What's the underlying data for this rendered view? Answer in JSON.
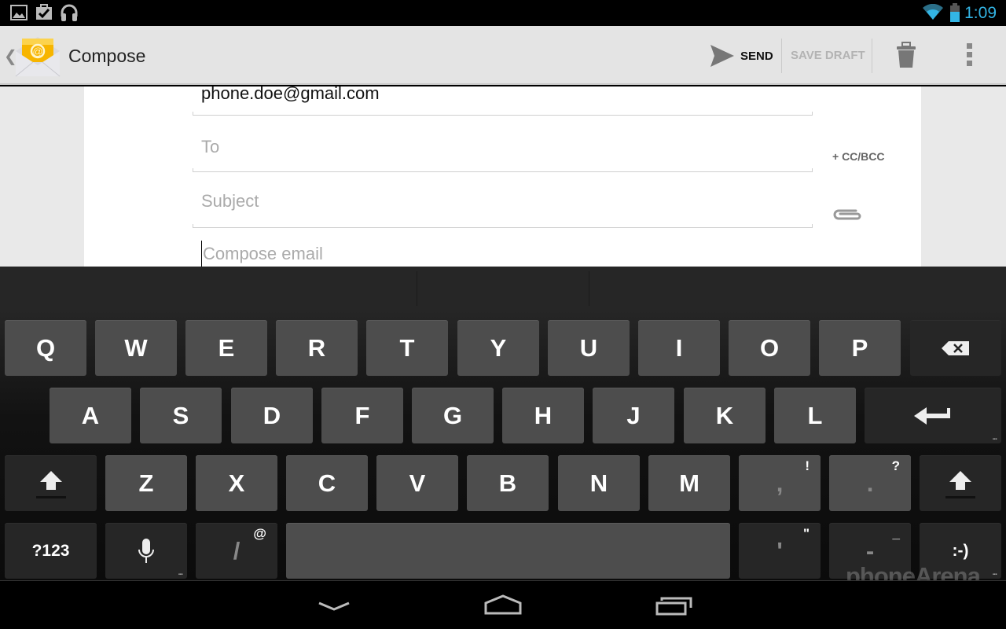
{
  "status_bar": {
    "left_icons": [
      "gallery-icon",
      "tasks-check-icon",
      "headphones-icon"
    ],
    "wifi": "wifi-icon",
    "battery": "battery-icon",
    "time": "1:09",
    "accent_color": "#33b5e5"
  },
  "action_bar": {
    "title": "Compose",
    "send_label": "SEND",
    "save_draft_label": "SAVE DRAFT",
    "delete_icon": "trash-icon",
    "overflow_icon": "overflow-menu-icon"
  },
  "compose": {
    "from": "phone.doe@gmail.com",
    "to_placeholder": "To",
    "subject_placeholder": "Subject",
    "body_placeholder": "Compose email",
    "cc_bcc_label": "+ CC/BCC",
    "attach_icon": "paperclip-icon"
  },
  "keyboard": {
    "row1": [
      "Q",
      "W",
      "E",
      "R",
      "T",
      "Y",
      "U",
      "I",
      "O",
      "P"
    ],
    "row2": [
      "A",
      "S",
      "D",
      "F",
      "G",
      "H",
      "J",
      "K",
      "L"
    ],
    "row3": [
      "Z",
      "X",
      "C",
      "V",
      "B",
      "N",
      "M"
    ],
    "comma": {
      "main": ",",
      "hint": "!"
    },
    "period": {
      "main": ".",
      "hint": "?"
    },
    "symbols_label": "?123",
    "slash": {
      "main": "/",
      "hint": "@"
    },
    "apostrophe": {
      "main": "'",
      "hint": "\""
    },
    "dash": {
      "main": "-",
      "hint": "_"
    },
    "smiley": ":-)",
    "more_dots": "..."
  },
  "watermark": "phoneArena"
}
